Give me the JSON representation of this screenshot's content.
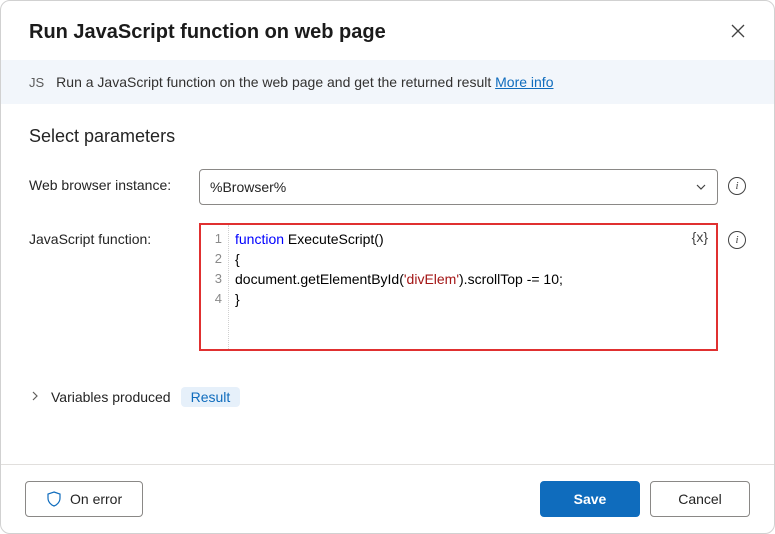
{
  "header": {
    "title": "Run JavaScript function on web page"
  },
  "info_bar": {
    "badge": "JS",
    "text": "Run a JavaScript function on the web page and get the returned result ",
    "link": "More info"
  },
  "section_title": "Select parameters",
  "form": {
    "browser_label": "Web browser instance:",
    "browser_value": "%Browser%",
    "js_label": "JavaScript function:",
    "code_lines": [
      {
        "n": 1,
        "segments": [
          [
            "kw",
            "function"
          ],
          [
            "plain",
            " ExecuteScript()"
          ]
        ]
      },
      {
        "n": 2,
        "segments": [
          [
            "plain",
            "{"
          ]
        ]
      },
      {
        "n": 3,
        "segments": [
          [
            "plain",
            "document.getElementById("
          ],
          [
            "str",
            "'divElem'"
          ],
          [
            "plain",
            ").scrollTop -= 10;"
          ]
        ]
      },
      {
        "n": 4,
        "segments": [
          [
            "plain",
            "}"
          ]
        ]
      }
    ],
    "var_badge": "{x}"
  },
  "vars_produced": {
    "label": "Variables produced",
    "pill": "Result"
  },
  "footer": {
    "on_error": "On error",
    "save": "Save",
    "cancel": "Cancel"
  }
}
